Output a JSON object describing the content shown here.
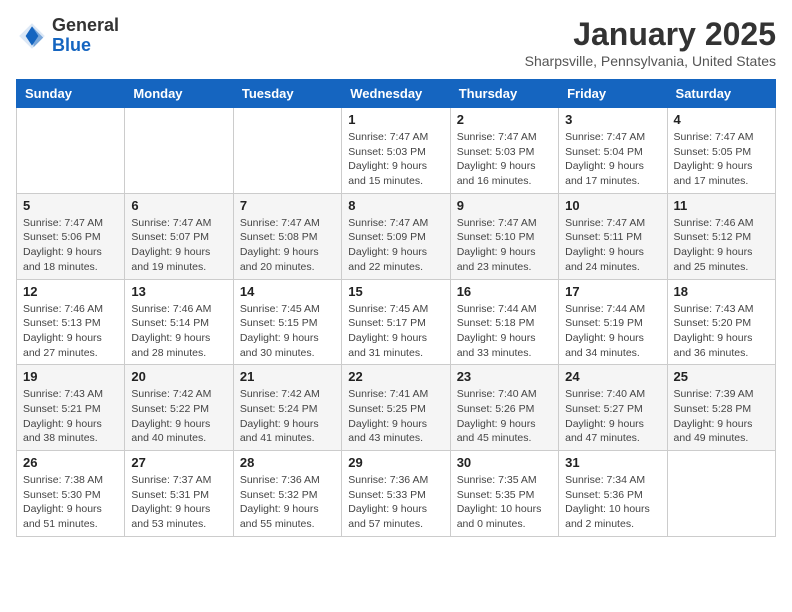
{
  "header": {
    "logo": {
      "general": "General",
      "blue": "Blue"
    },
    "title": "January 2025",
    "location": "Sharpsville, Pennsylvania, United States"
  },
  "days_of_week": [
    "Sunday",
    "Monday",
    "Tuesday",
    "Wednesday",
    "Thursday",
    "Friday",
    "Saturday"
  ],
  "weeks": [
    [
      null,
      null,
      null,
      {
        "day": 1,
        "sunrise": "7:47 AM",
        "sunset": "5:03 PM",
        "daylight": "9 hours and 15 minutes."
      },
      {
        "day": 2,
        "sunrise": "7:47 AM",
        "sunset": "5:03 PM",
        "daylight": "9 hours and 16 minutes."
      },
      {
        "day": 3,
        "sunrise": "7:47 AM",
        "sunset": "5:04 PM",
        "daylight": "9 hours and 17 minutes."
      },
      {
        "day": 4,
        "sunrise": "7:47 AM",
        "sunset": "5:05 PM",
        "daylight": "9 hours and 17 minutes."
      }
    ],
    [
      {
        "day": 5,
        "sunrise": "7:47 AM",
        "sunset": "5:06 PM",
        "daylight": "9 hours and 18 minutes."
      },
      {
        "day": 6,
        "sunrise": "7:47 AM",
        "sunset": "5:07 PM",
        "daylight": "9 hours and 19 minutes."
      },
      {
        "day": 7,
        "sunrise": "7:47 AM",
        "sunset": "5:08 PM",
        "daylight": "9 hours and 20 minutes."
      },
      {
        "day": 8,
        "sunrise": "7:47 AM",
        "sunset": "5:09 PM",
        "daylight": "9 hours and 22 minutes."
      },
      {
        "day": 9,
        "sunrise": "7:47 AM",
        "sunset": "5:10 PM",
        "daylight": "9 hours and 23 minutes."
      },
      {
        "day": 10,
        "sunrise": "7:47 AM",
        "sunset": "5:11 PM",
        "daylight": "9 hours and 24 minutes."
      },
      {
        "day": 11,
        "sunrise": "7:46 AM",
        "sunset": "5:12 PM",
        "daylight": "9 hours and 25 minutes."
      }
    ],
    [
      {
        "day": 12,
        "sunrise": "7:46 AM",
        "sunset": "5:13 PM",
        "daylight": "9 hours and 27 minutes."
      },
      {
        "day": 13,
        "sunrise": "7:46 AM",
        "sunset": "5:14 PM",
        "daylight": "9 hours and 28 minutes."
      },
      {
        "day": 14,
        "sunrise": "7:45 AM",
        "sunset": "5:15 PM",
        "daylight": "9 hours and 30 minutes."
      },
      {
        "day": 15,
        "sunrise": "7:45 AM",
        "sunset": "5:17 PM",
        "daylight": "9 hours and 31 minutes."
      },
      {
        "day": 16,
        "sunrise": "7:44 AM",
        "sunset": "5:18 PM",
        "daylight": "9 hours and 33 minutes."
      },
      {
        "day": 17,
        "sunrise": "7:44 AM",
        "sunset": "5:19 PM",
        "daylight": "9 hours and 34 minutes."
      },
      {
        "day": 18,
        "sunrise": "7:43 AM",
        "sunset": "5:20 PM",
        "daylight": "9 hours and 36 minutes."
      }
    ],
    [
      {
        "day": 19,
        "sunrise": "7:43 AM",
        "sunset": "5:21 PM",
        "daylight": "9 hours and 38 minutes."
      },
      {
        "day": 20,
        "sunrise": "7:42 AM",
        "sunset": "5:22 PM",
        "daylight": "9 hours and 40 minutes."
      },
      {
        "day": 21,
        "sunrise": "7:42 AM",
        "sunset": "5:24 PM",
        "daylight": "9 hours and 41 minutes."
      },
      {
        "day": 22,
        "sunrise": "7:41 AM",
        "sunset": "5:25 PM",
        "daylight": "9 hours and 43 minutes."
      },
      {
        "day": 23,
        "sunrise": "7:40 AM",
        "sunset": "5:26 PM",
        "daylight": "9 hours and 45 minutes."
      },
      {
        "day": 24,
        "sunrise": "7:40 AM",
        "sunset": "5:27 PM",
        "daylight": "9 hours and 47 minutes."
      },
      {
        "day": 25,
        "sunrise": "7:39 AM",
        "sunset": "5:28 PM",
        "daylight": "9 hours and 49 minutes."
      }
    ],
    [
      {
        "day": 26,
        "sunrise": "7:38 AM",
        "sunset": "5:30 PM",
        "daylight": "9 hours and 51 minutes."
      },
      {
        "day": 27,
        "sunrise": "7:37 AM",
        "sunset": "5:31 PM",
        "daylight": "9 hours and 53 minutes."
      },
      {
        "day": 28,
        "sunrise": "7:36 AM",
        "sunset": "5:32 PM",
        "daylight": "9 hours and 55 minutes."
      },
      {
        "day": 29,
        "sunrise": "7:36 AM",
        "sunset": "5:33 PM",
        "daylight": "9 hours and 57 minutes."
      },
      {
        "day": 30,
        "sunrise": "7:35 AM",
        "sunset": "5:35 PM",
        "daylight": "10 hours and 0 minutes."
      },
      {
        "day": 31,
        "sunrise": "7:34 AM",
        "sunset": "5:36 PM",
        "daylight": "10 hours and 2 minutes."
      },
      null
    ]
  ]
}
